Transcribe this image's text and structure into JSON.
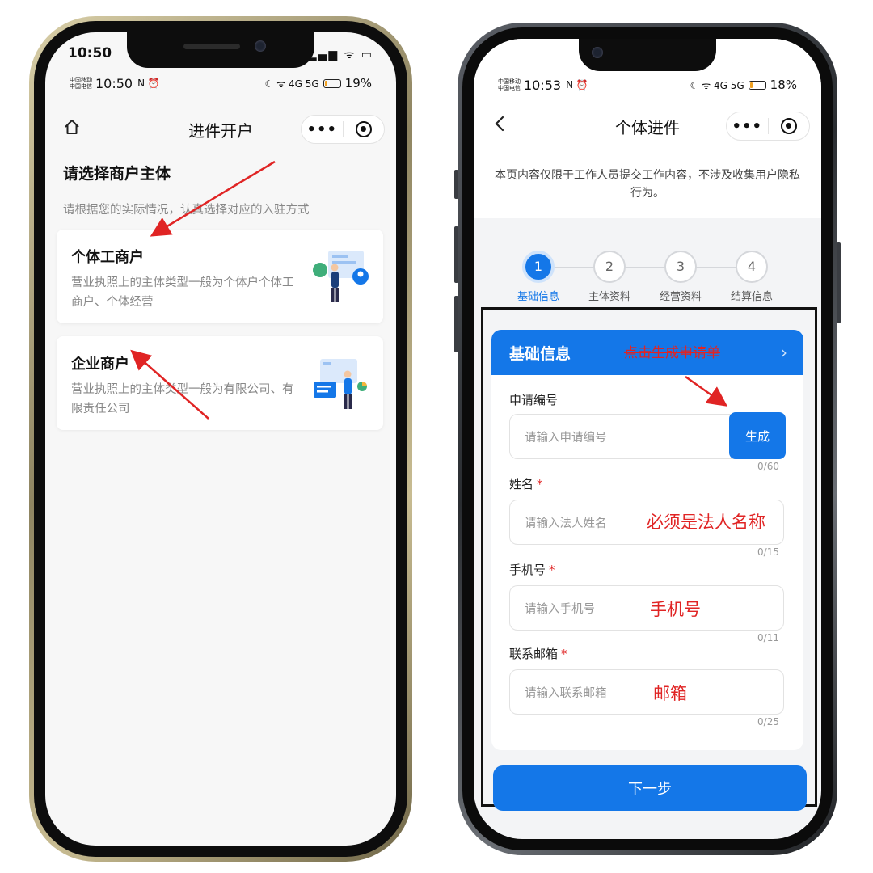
{
  "left": {
    "top_time": "10:50",
    "status": {
      "carrier1": "中国移动",
      "carrier2": "中国电信",
      "time": "10:50",
      "misc": "N ⏰",
      "network": "☾ ᯤ 4G 5G",
      "battery_pct": "19%",
      "battery_level": 0.19
    },
    "nav": {
      "title": "进件开户",
      "more": "•••"
    },
    "heading": "请选择商户主体",
    "subheading": "请根据您的实际情况，认真选择对应的入驻方式",
    "cards": [
      {
        "title": "个体工商户",
        "desc": "营业执照上的主体类型一般为个体户个体工商户、个体经营"
      },
      {
        "title": "企业商户",
        "desc": "营业执照上的主体类型一般为有限公司、有限责任公司"
      }
    ]
  },
  "right": {
    "status": {
      "carrier1": "中国移动",
      "carrier2": "中国电信",
      "time": "10:53",
      "misc": "N ⏰",
      "network": "☾ ᯤ 4G 5G",
      "battery_pct": "18%",
      "battery_level": 0.18
    },
    "nav": {
      "title": "个体进件",
      "more": "•••"
    },
    "notice": "本页内容仅限于工作人员提交工作内容，不涉及收集用户隐私行为。",
    "steps": [
      {
        "num": "1",
        "label": "基础信息",
        "active": true
      },
      {
        "num": "2",
        "label": "主体资料",
        "active": false
      },
      {
        "num": "3",
        "label": "经营资料",
        "active": false
      },
      {
        "num": "4",
        "label": "结算信息",
        "active": false
      }
    ],
    "form": {
      "header": "基础信息",
      "header_annotation": "点击生成申请单",
      "fields": [
        {
          "label": "申请编号",
          "required": false,
          "placeholder": "请输入申请编号",
          "counter": "0/60",
          "button": "生成",
          "annotation": ""
        },
        {
          "label": "姓名",
          "required": true,
          "placeholder": "请输入法人姓名",
          "counter": "0/15",
          "annotation": "必须是法人名称"
        },
        {
          "label": "手机号",
          "required": true,
          "placeholder": "请输入手机号",
          "counter": "0/11",
          "annotation": "手机号"
        },
        {
          "label": "联系邮箱",
          "required": true,
          "placeholder": "请输入联系邮箱",
          "counter": "0/25",
          "annotation": "邮箱"
        }
      ],
      "required_mark": "*"
    },
    "next_button": "下一步"
  },
  "colors": {
    "primary": "#1477e8",
    "annotation_red": "#e02424"
  }
}
